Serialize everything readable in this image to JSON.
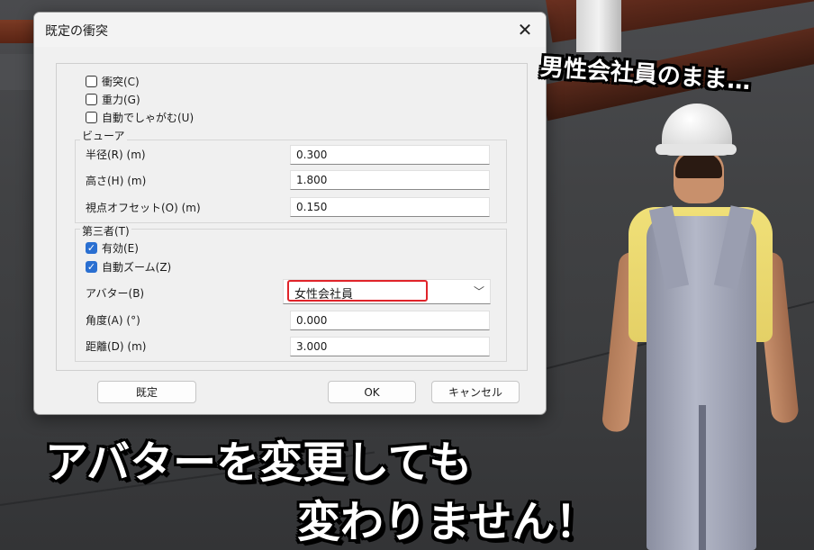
{
  "dialog": {
    "title": "既定の衝突",
    "close_glyph": "✕",
    "checkboxes": [
      {
        "label": "衝突(C)",
        "checked": false
      },
      {
        "label": "重力(G)",
        "checked": false
      },
      {
        "label": "自動でしゃがむ(U)",
        "checked": false
      }
    ],
    "viewer": {
      "group_label": "ビューア",
      "radius_label": "半径(R) (m)",
      "radius_value": "0.300",
      "height_label": "高さ(H) (m)",
      "height_value": "1.800",
      "eye_offset_label": "視点オフセット(O) (m)",
      "eye_offset_value": "0.150"
    },
    "third_person": {
      "group_label": "第三者(T)",
      "enabled_label": "有効(E)",
      "enabled_checked": true,
      "auto_zoom_label": "自動ズーム(Z)",
      "auto_zoom_checked": true,
      "avatar_label": "アバター(B)",
      "avatar_value": "女性会社員",
      "angle_label": "角度(A) (°)",
      "angle_value": "0.000",
      "distance_label": "距離(D) (m)",
      "distance_value": "3.000"
    },
    "buttons": {
      "default": "既定",
      "ok": "OK",
      "cancel": "キャンセル"
    }
  },
  "captions": {
    "top_right": "男性会社員のまま…",
    "line1": "アバターを変更しても",
    "line2": "変わりません！"
  },
  "colors": {
    "highlight_border": "#e0242a",
    "checkbox_checked": "#2a6fd1"
  },
  "icons": {
    "close": "close-icon",
    "dropdown": "chevron-down-icon",
    "check": "check-icon"
  }
}
